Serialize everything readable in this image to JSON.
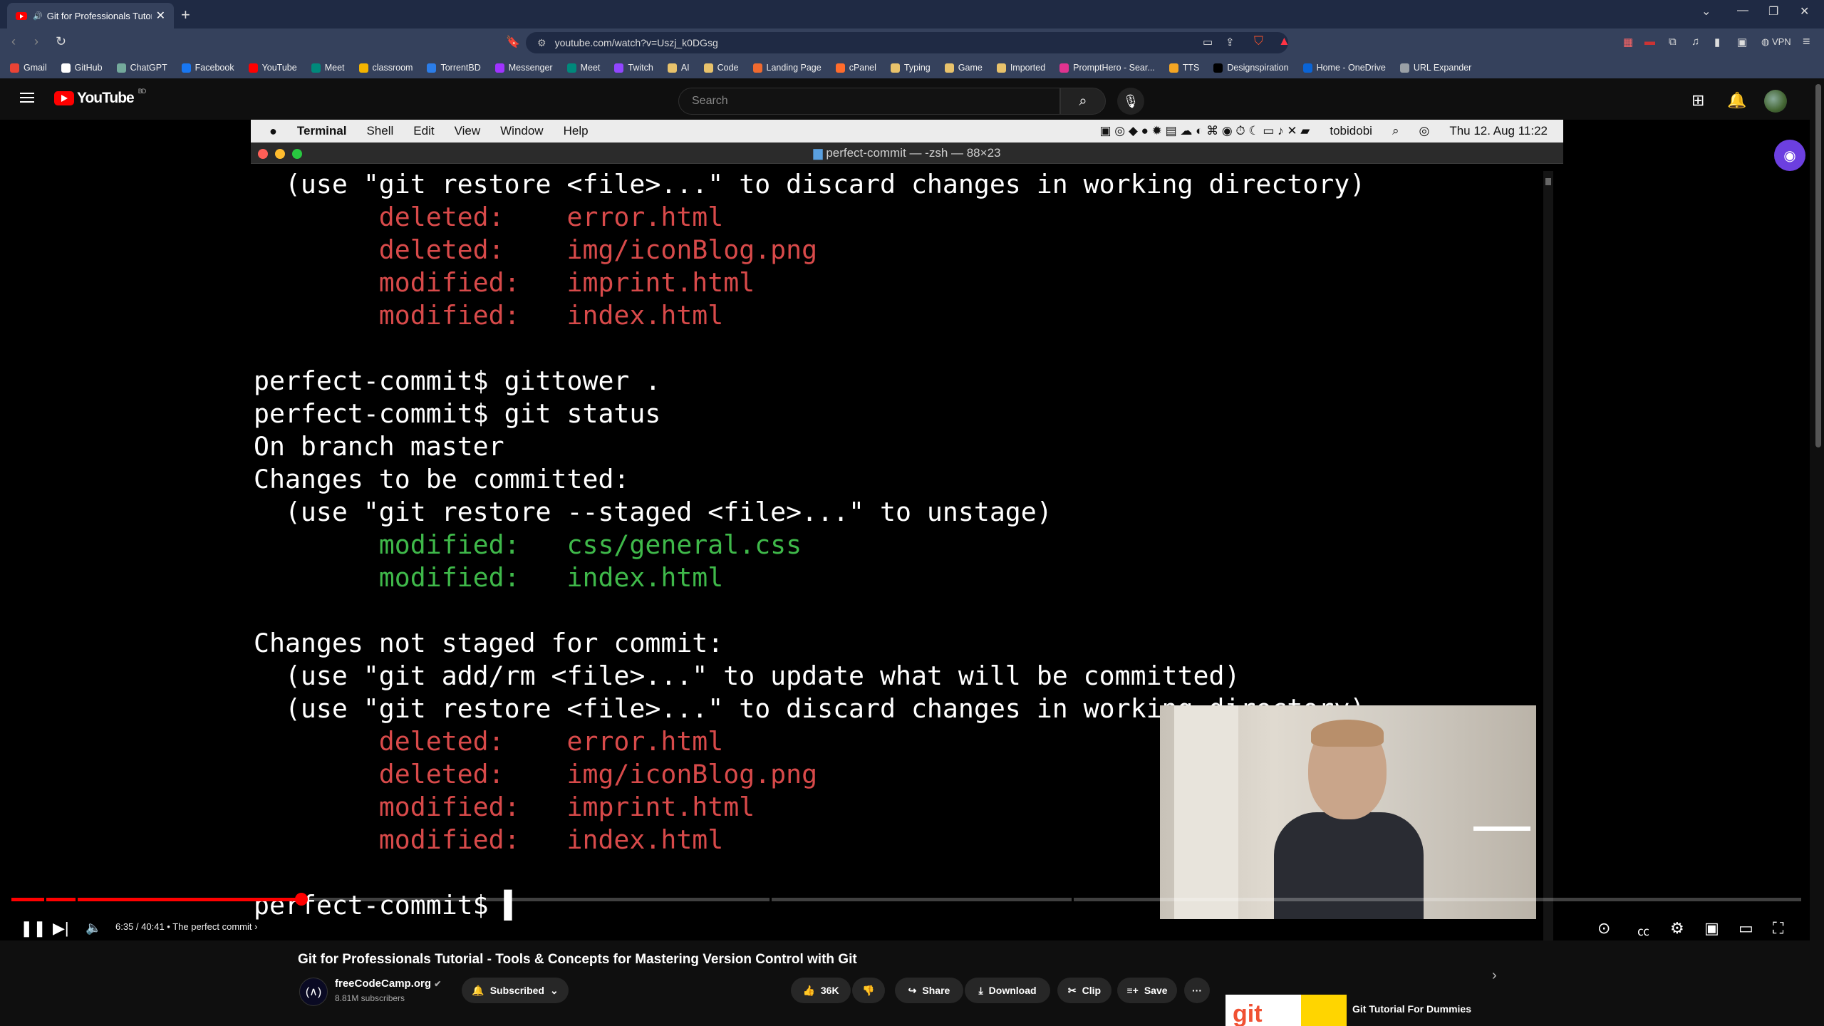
{
  "browser": {
    "tab_title": "Git for Professionals Tutorial",
    "new_tab": "+",
    "url": "youtube.com/watch?v=Uszj_k0DGsg",
    "vpn_label": "VPN",
    "bookmarks": [
      {
        "label": "Gmail",
        "color": "#ea4335"
      },
      {
        "label": "GitHub",
        "color": "#ffffff"
      },
      {
        "label": "ChatGPT",
        "color": "#74aa9c"
      },
      {
        "label": "Facebook",
        "color": "#1877f2"
      },
      {
        "label": "YouTube",
        "color": "#ff0000"
      },
      {
        "label": "Meet",
        "color": "#00897b"
      },
      {
        "label": "classroom",
        "color": "#f4b400"
      },
      {
        "label": "TorrentBD",
        "color": "#2b7de9"
      },
      {
        "label": "Messenger",
        "color": "#a033ff"
      },
      {
        "label": "Meet",
        "color": "#00897b"
      },
      {
        "label": "Twitch",
        "color": "#9146ff"
      },
      {
        "label": "AI",
        "color": "#e8c26b"
      },
      {
        "label": "Code",
        "color": "#e8c26b"
      },
      {
        "label": "Landing Page",
        "color": "#f06a2f"
      },
      {
        "label": "cPanel",
        "color": "#ff6c2c"
      },
      {
        "label": "Typing",
        "color": "#e8c26b"
      },
      {
        "label": "Game",
        "color": "#e8c26b"
      },
      {
        "label": "Imported",
        "color": "#e8c26b"
      },
      {
        "label": "PromptHero - Sear...",
        "color": "#e0338f"
      },
      {
        "label": "TTS",
        "color": "#f5a623"
      },
      {
        "label": "Designspiration",
        "color": "#000000"
      },
      {
        "label": "Home - OneDrive",
        "color": "#0a64d6"
      },
      {
        "label": "URL Expander",
        "color": "#9aa0a6"
      }
    ]
  },
  "youtube": {
    "logo_text": "YouTube",
    "logo_country": "BD",
    "search_placeholder": "Search"
  },
  "mac": {
    "app": "Terminal",
    "menus": [
      "Shell",
      "Edit",
      "View",
      "Window",
      "Help"
    ],
    "user": "tobidobi",
    "clock": "Thu 12. Aug  11:22",
    "window_title": "perfect-commit — -zsh — 88×23"
  },
  "terminal_lines": [
    {
      "t": "  (use \"git restore <file>...\" to discard changes in working directory)",
      "c": ""
    },
    {
      "t": "        deleted:    error.html",
      "c": "r"
    },
    {
      "t": "        deleted:    img/iconBlog.png",
      "c": "r"
    },
    {
      "t": "        modified:   imprint.html",
      "c": "r"
    },
    {
      "t": "        modified:   index.html",
      "c": "r"
    },
    {
      "t": "",
      "c": ""
    },
    {
      "t": "perfect-commit$ gittower .",
      "c": ""
    },
    {
      "t": "perfect-commit$ git status",
      "c": ""
    },
    {
      "t": "On branch master",
      "c": ""
    },
    {
      "t": "Changes to be committed:",
      "c": ""
    },
    {
      "t": "  (use \"git restore --staged <file>...\" to unstage)",
      "c": ""
    },
    {
      "t": "        modified:   css/general.css",
      "c": "g"
    },
    {
      "t": "        modified:   index.html",
      "c": "g"
    },
    {
      "t": "",
      "c": ""
    },
    {
      "t": "Changes not staged for commit:",
      "c": ""
    },
    {
      "t": "  (use \"git add/rm <file>...\" to update what will be committed)",
      "c": ""
    },
    {
      "t": "  (use \"git restore <file>...\" to discard changes in working directory)",
      "c": ""
    },
    {
      "t": "        deleted:    error.html",
      "c": "r"
    },
    {
      "t": "        deleted:    img/iconBlog.png",
      "c": "r"
    },
    {
      "t": "        modified:   imprint.html",
      "c": "r"
    },
    {
      "t": "        modified:   index.html",
      "c": "r"
    },
    {
      "t": "",
      "c": ""
    },
    {
      "t": "perfect-commit$ ▌",
      "c": ""
    }
  ],
  "player": {
    "time": "6:35 / 40:41",
    "chapter": "The perfect commit",
    "progress_fraction": 0.162
  },
  "video": {
    "title": "Git for Professionals Tutorial - Tools & Concepts for Mastering Version Control with Git",
    "channel": "freeCodeCamp.org",
    "subscribers": "8.81M subscribers",
    "subscribed_label": "Subscribed",
    "likes": "36K",
    "share": "Share",
    "download": "Download",
    "clip": "Clip",
    "save": "Save",
    "more": "···"
  },
  "recommendation": {
    "thumb_text": "git",
    "title": "Git Tutorial For Dummies"
  }
}
